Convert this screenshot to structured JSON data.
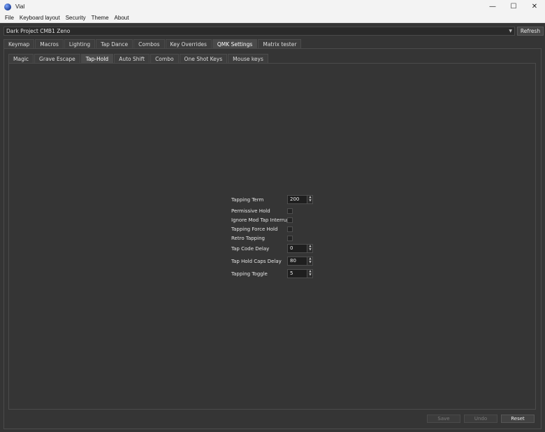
{
  "window": {
    "title": "Vial",
    "minimize": "—",
    "maximize": "☐",
    "close": "✕"
  },
  "menu": [
    "File",
    "Keyboard layout",
    "Security",
    "Theme",
    "About"
  ],
  "device": {
    "selected": "Dark Project CMB1 Zeno",
    "refresh_label": "Refresh"
  },
  "top_tabs": [
    "Keymap",
    "Macros",
    "Lighting",
    "Tap Dance",
    "Combos",
    "Key Overrides",
    "QMK Settings",
    "Matrix tester"
  ],
  "top_tab_active": "QMK Settings",
  "sub_tabs": [
    "Magic",
    "Grave Escape",
    "Tap-Hold",
    "Auto Shift",
    "Combo",
    "One Shot Keys",
    "Mouse keys"
  ],
  "sub_tab_active": "Tap-Hold",
  "settings": {
    "tapping_term": {
      "label": "Tapping Term",
      "value": "200"
    },
    "permissive_hold": {
      "label": "Permissive Hold",
      "checked": false
    },
    "ignore_mod_tap_interrupt": {
      "label": "Ignore Mod Tap Interrupt",
      "checked": false
    },
    "tapping_force_hold": {
      "label": "Tapping Force Hold",
      "checked": false
    },
    "retro_tapping": {
      "label": "Retro Tapping",
      "checked": false
    },
    "tap_code_delay": {
      "label": "Tap Code Delay",
      "value": "0"
    },
    "tap_hold_caps_delay": {
      "label": "Tap Hold Caps Delay",
      "value": "80"
    },
    "tapping_toggle": {
      "label": "Tapping Toggle",
      "value": "5"
    }
  },
  "buttons": {
    "save": "Save",
    "undo": "Undo",
    "reset": "Reset"
  },
  "icons": {
    "spin_up": "▲",
    "spin_down": "▼",
    "dropdown": "▼"
  }
}
